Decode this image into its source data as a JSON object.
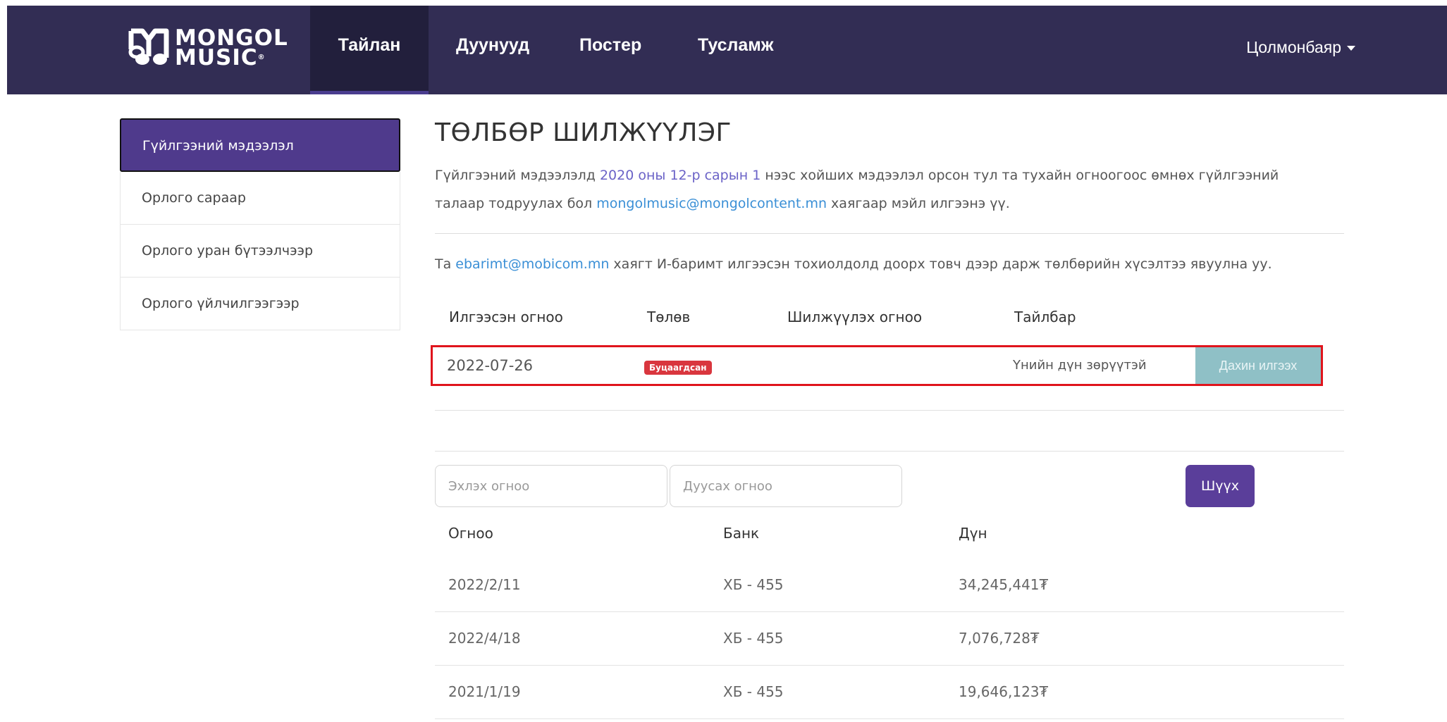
{
  "brand": {
    "line1": "MONGOL",
    "line2": "MUSIC",
    "reg": "®"
  },
  "nav": {
    "items": [
      "Тайлан",
      "Дуунууд",
      "Постер",
      "Тусламж"
    ],
    "user": "Цолмонбаяр"
  },
  "sidebar": {
    "items": [
      "Гүйлгээний мэдээлэл",
      "Орлого сараар",
      "Орлого уран бүтээлчээр",
      "Орлого үйлчилгээгээр"
    ]
  },
  "main": {
    "title": "ТӨЛБӨР ШИЛЖҮҮЛЭГ",
    "intro_1": "Гүйлгээний мэдээлэлд ",
    "intro_date": "2020 оны 12-р сарын 1",
    "intro_2": " нээс хойших мэдээлэл орсон тул та тухайн огноогоос өмнөх гүйлгээний",
    "intro_3": "талаар тодруулах бол ",
    "intro_email": "mongolmusic@mongolcontent.mn",
    "intro_4": " хаягаар мэйл илгээнэ үү.",
    "ebarimt_1": "Та ",
    "ebarimt_email": "ebarimt@mobicom.mn",
    "ebarimt_2": " хаягт И-баримт илгээсэн тохиолдолд доорх товч дээр дарж төлбөрийн хүсэлтээ явуулна уу."
  },
  "request_table": {
    "headers": [
      "Илгээсэн огноо",
      "Төлөв",
      "Шилжүүлэх огноо",
      "Тайлбар"
    ],
    "row": {
      "sent_date": "2022-07-26",
      "status": "Буцаагдсан",
      "transfer_date": "",
      "note": "Үнийн дүн зөрүүтэй",
      "action": "Дахин илгээх"
    }
  },
  "filter": {
    "start_placeholder": "Эхлэх огноо",
    "end_placeholder": "Дуусах огноо",
    "button": "Шүүх"
  },
  "transactions": {
    "headers": [
      "Огноо",
      "Банк",
      "Дүн"
    ],
    "rows": [
      {
        "date": "2022/2/11",
        "bank": "ХБ - 455",
        "amount": "34,245,441₮"
      },
      {
        "date": "2022/4/18",
        "bank": "ХБ - 455",
        "amount": "7,076,728₮"
      },
      {
        "date": "2021/1/19",
        "bank": "ХБ - 455",
        "amount": "19,646,123₮"
      }
    ]
  },
  "colors": {
    "navbar": "#322d54",
    "accent": "#4f3a8c",
    "danger": "#d9363e",
    "resend": "#8fc0c6",
    "highlight": "#e0141c"
  }
}
